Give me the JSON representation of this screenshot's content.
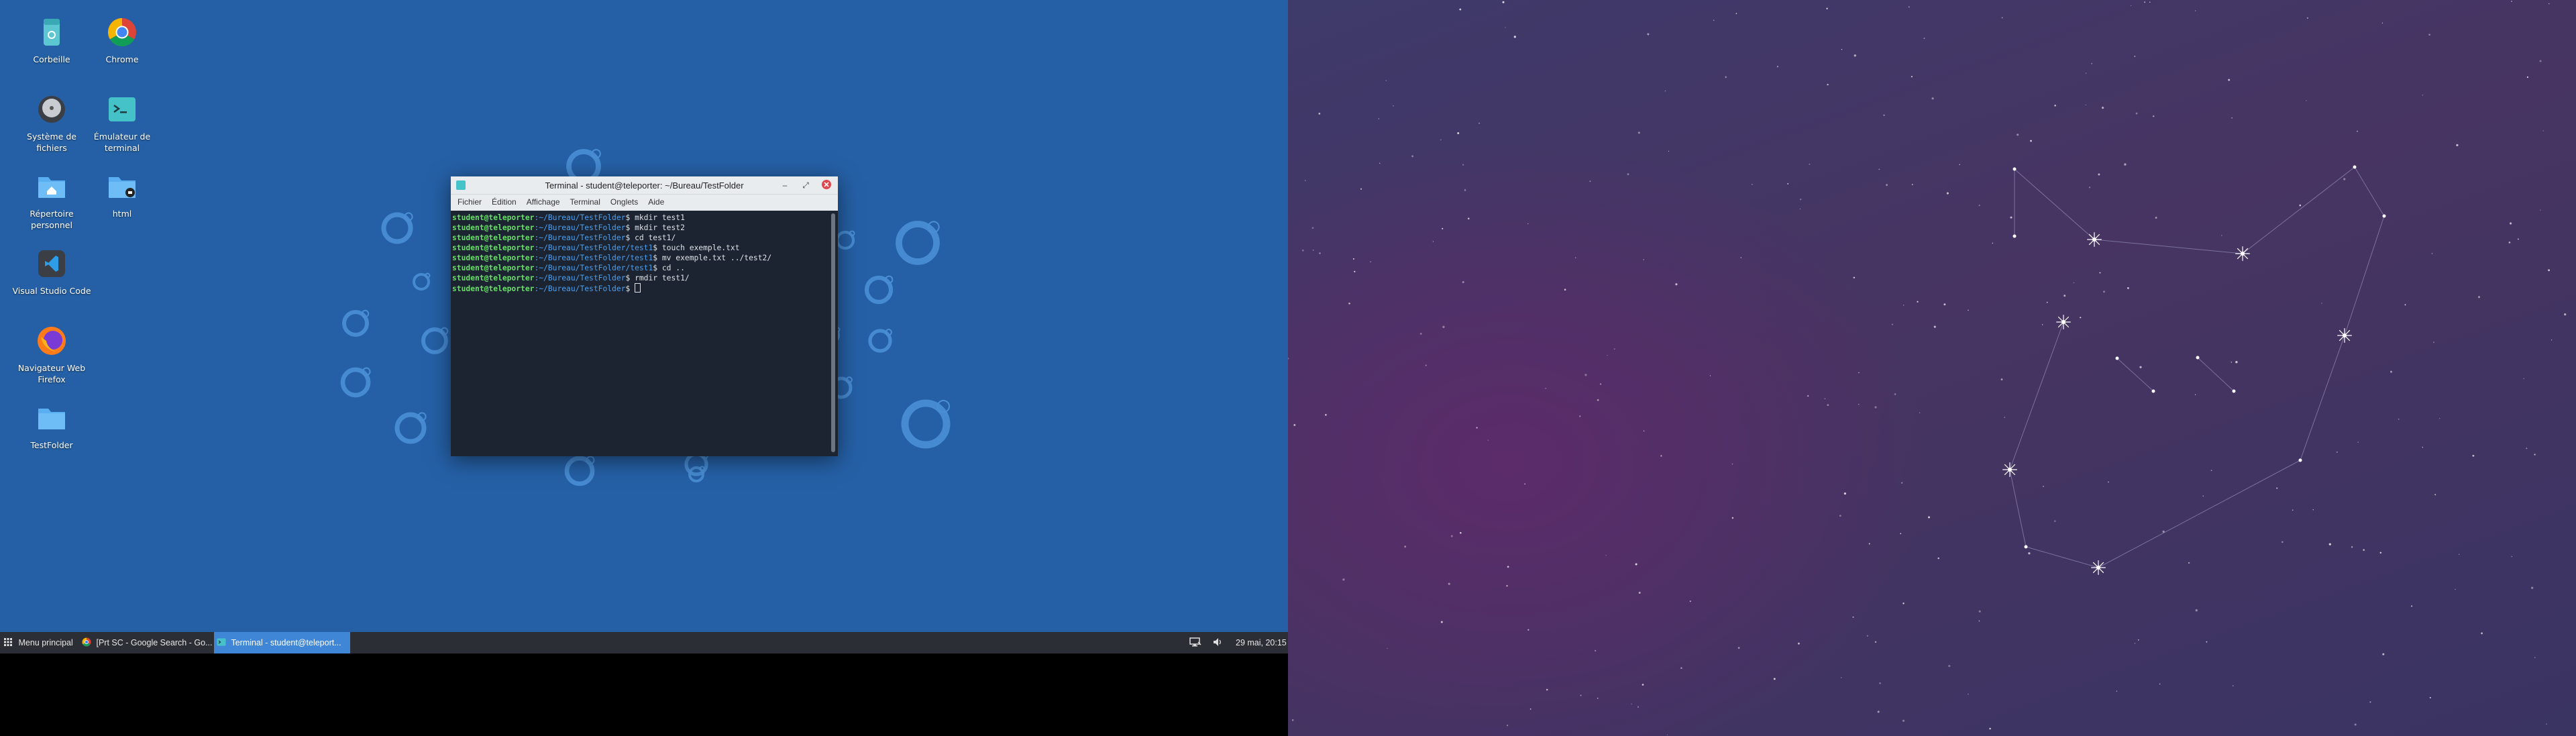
{
  "desktop_icons": [
    {
      "label": "Corbeille",
      "icon": "trash-icon"
    },
    {
      "label": "Chrome",
      "icon": "chrome-icon"
    },
    {
      "label": "Système de fichiers",
      "icon": "drive-icon"
    },
    {
      "label": "Émulateur de terminal",
      "icon": "terminal-icon"
    },
    {
      "label": "Répertoire personnel",
      "icon": "home-folder-icon"
    },
    {
      "label": "html",
      "icon": "folder-icon"
    },
    {
      "label": "Visual Studio Code",
      "icon": "vscode-icon"
    },
    {
      "label": "Navigateur Web Firefox",
      "icon": "firefox-icon"
    },
    {
      "label": "TestFolder",
      "icon": "folder-icon"
    }
  ],
  "terminal": {
    "title": "Terminal - student@teleporter: ~/Bureau/TestFolder",
    "menu": [
      "Fichier",
      "Édition",
      "Affichage",
      "Terminal",
      "Onglets",
      "Aide"
    ],
    "lines": [
      {
        "user": "student@teleporter",
        "path": ":~/Bureau/TestFolder",
        "cmd": "$ mkdir test1"
      },
      {
        "user": "student@teleporter",
        "path": ":~/Bureau/TestFolder",
        "cmd": "$ mkdir test2"
      },
      {
        "user": "student@teleporter",
        "path": ":~/Bureau/TestFolder",
        "cmd": "$ cd test1/"
      },
      {
        "user": "student@teleporter",
        "path": ":~/Bureau/TestFolder/test1",
        "cmd": "$ touch exemple.txt"
      },
      {
        "user": "student@teleporter",
        "path": ":~/Bureau/TestFolder/test1",
        "cmd": "$ mv exemple.txt ../test2/"
      },
      {
        "user": "student@teleporter",
        "path": ":~/Bureau/TestFolder/test1",
        "cmd": "$ cd .."
      },
      {
        "user": "student@teleporter",
        "path": ":~/Bureau/TestFolder",
        "cmd": "$ rmdir test1/"
      },
      {
        "user": "student@teleporter",
        "path": ":~/Bureau/TestFolder",
        "cmd": "$ "
      }
    ]
  },
  "taskbar": {
    "menu_label": "Menu principal",
    "tasks": [
      "[Prt SC - Google Search - Go...",
      "Terminal - student@teleport..."
    ],
    "clock": "29 mai, 20:15"
  },
  "colors": {
    "desktop": "#2560a6",
    "accent": "#3f86d6",
    "prompt_user": "#66e066",
    "prompt_path": "#4d9ff0"
  }
}
